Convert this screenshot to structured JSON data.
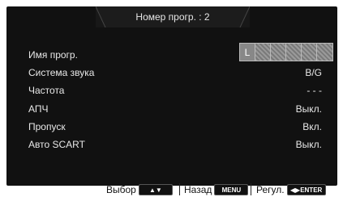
{
  "header": {
    "title": "Номер прогр. : 2"
  },
  "menu": {
    "items": [
      {
        "label": "Имя прогр.",
        "value": ""
      },
      {
        "label": "Система звука",
        "value": "B/G"
      },
      {
        "label": "Частота",
        "value": "- - -"
      },
      {
        "label": "АПЧ",
        "value": "Выкл."
      },
      {
        "label": "Пропуск",
        "value": "Вкл."
      },
      {
        "label": "Авто SCART",
        "value": "Выкл."
      }
    ],
    "name_chars": [
      "L",
      "",
      "",
      "",
      "",
      ""
    ]
  },
  "footer": {
    "select_label": "Выбор",
    "select_key": "▲▼",
    "back_label": "Назад",
    "back_key": "MENU",
    "adjust_label": "Регул.",
    "adjust_key": "◀▶ENTER"
  },
  "colors": {
    "background": "#111111",
    "text": "#e8e8e8",
    "page": "#ffffff"
  }
}
